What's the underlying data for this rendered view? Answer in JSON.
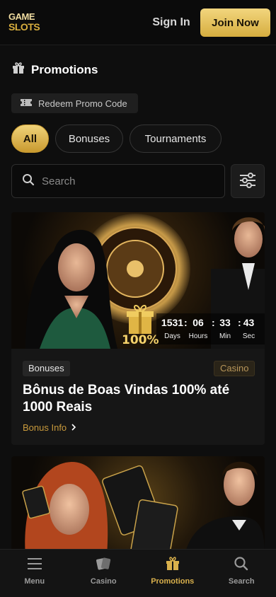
{
  "header": {
    "logo_line1": "GAME",
    "logo_line2": "SLOTS",
    "sign_in": "Sign In",
    "join_now": "Join Now"
  },
  "page": {
    "title": "Promotions",
    "redeem_label": "Redeem Promo Code"
  },
  "tabs": [
    {
      "label": "All",
      "active": true
    },
    {
      "label": "Bonuses",
      "active": false
    },
    {
      "label": "Tournaments",
      "active": false
    }
  ],
  "search": {
    "placeholder": "Search"
  },
  "promo_card": {
    "badge_type": "Bonuses",
    "badge_category": "Casino",
    "title": "Bônus de Boas Vindas 100% até 1000 Reais",
    "link_label": "Bonus Info",
    "percent": "100%",
    "countdown": {
      "days": "1531",
      "hours": "06",
      "min": "33",
      "sec": "43",
      "days_label": "Days",
      "hours_label": "Hours",
      "min_label": "Min",
      "sec_label": "Sec"
    }
  },
  "bottom_nav": [
    {
      "label": "Menu",
      "icon": "menu-icon",
      "active": false
    },
    {
      "label": "Casino",
      "icon": "cards-icon",
      "active": false
    },
    {
      "label": "Promotions",
      "icon": "gift-icon",
      "active": true
    },
    {
      "label": "Search",
      "icon": "search-icon",
      "active": false
    }
  ],
  "colors": {
    "accent_gold": "#d9b04c",
    "background": "#0e0e0e",
    "card": "#161616"
  }
}
